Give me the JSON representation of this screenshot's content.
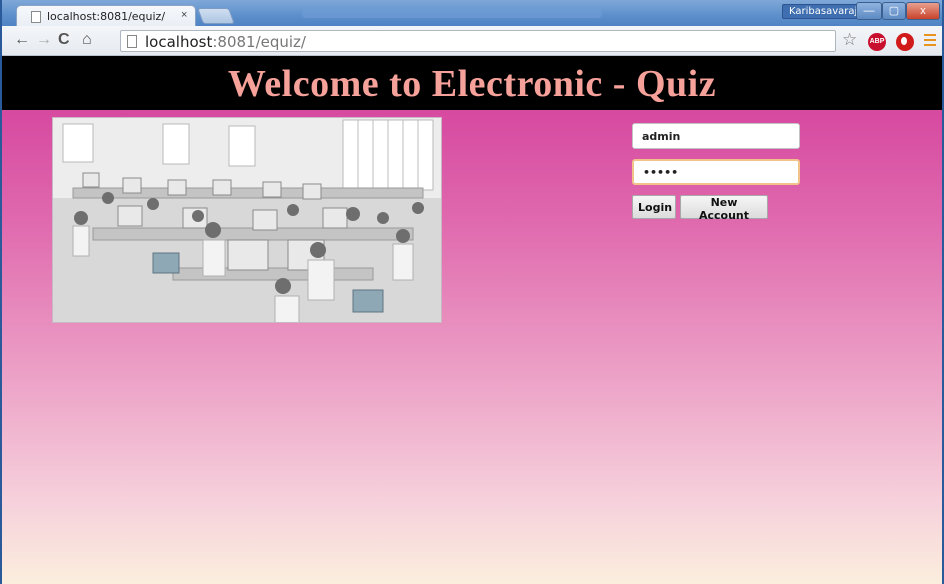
{
  "browser": {
    "tab_title": "localhost:8081/equiz/",
    "tab_close": "×",
    "user_name": "Karibasavaraj",
    "url_host": "localhost",
    "url_path": ":8081/equiz/",
    "back_glyph": "←",
    "forward_glyph": "→",
    "reload_glyph": "C",
    "home_glyph": "⌂",
    "star_glyph": "☆",
    "abp_label": "ABP",
    "min_glyph": "—",
    "max_glyph": "▢",
    "close_glyph": "x",
    "icons": [
      "page-icon",
      "back-icon",
      "forward-icon",
      "reload-icon",
      "home-icon",
      "star-icon",
      "adblock-icon",
      "opera-icon",
      "menu-icon"
    ]
  },
  "page": {
    "heading": "Welcome to Electronic - Quiz",
    "photo_alt": "computer lab",
    "login": {
      "username_value": "admin",
      "password_value": "•••••",
      "login_button": "Login",
      "new_account_button": "New Account"
    }
  },
  "colors": {
    "banner_bg": "#000000",
    "heading_text": "#f6a19a",
    "page_gradient_top": "#d23a99",
    "page_gradient_bottom": "#fbeedd"
  }
}
